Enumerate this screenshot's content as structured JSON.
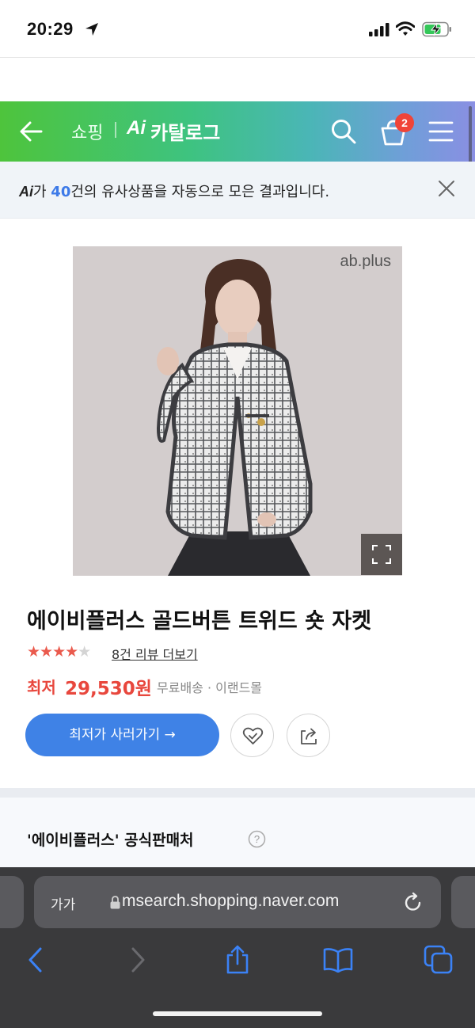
{
  "status_bar": {
    "time": "20:29"
  },
  "header": {
    "shopping_label": "쇼핑",
    "ai_label": "Ai",
    "catalog_label": "카탈로그",
    "cart_count": "2"
  },
  "ai_notice": {
    "ai": "Ai",
    "prefix": "가 ",
    "count": "40",
    "suffix": "건의 유사상품을 자동으로 모은 결과입니다."
  },
  "product": {
    "brand_watermark": "ab.plus",
    "title": "에이비플러스 골드버튼 트위드 숏 자켓",
    "rating_stars": 4,
    "rating_max": 5,
    "stars_on": "★★★★",
    "stars_off": "★",
    "review_link": "8건 리뷰 더보기",
    "price_label": "최저",
    "price_value": "29,530원",
    "shipping": "무료배송 · 이랜드몰",
    "buy_button": "최저가 사러가기 →"
  },
  "seller": {
    "title": "'에이비플러스' 공식판매처"
  },
  "browser": {
    "text_size": "가가",
    "url": "msearch.shopping.naver.com"
  },
  "colors": {
    "accent_blue": "#3f82e6",
    "price_red": "#e8473d",
    "header_green": "#4ec43c",
    "header_purple": "#8a8fe3"
  },
  "icons": [
    "location-arrow-icon",
    "cellular-signal-icon",
    "wifi-icon",
    "battery-charging-icon",
    "back-arrow-icon",
    "search-icon",
    "shopping-bag-icon",
    "hamburger-menu-icon",
    "close-icon",
    "expand-icon",
    "heart-check-icon",
    "share-icon",
    "help-icon",
    "lock-icon",
    "reload-icon",
    "safari-back-icon",
    "safari-forward-icon",
    "safari-share-icon",
    "bookmarks-icon",
    "tabs-icon"
  ]
}
